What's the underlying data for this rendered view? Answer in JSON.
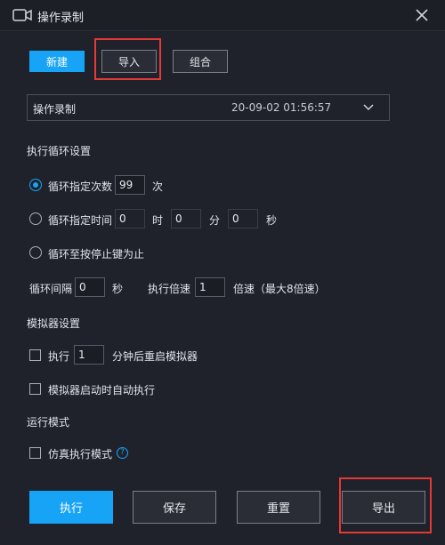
{
  "window": {
    "title": "操作录制",
    "close_icon": "close-icon"
  },
  "toolbar": {
    "new_label": "新建",
    "import_label": "导入",
    "combine_label": "组合"
  },
  "recording": {
    "name": "操作录制",
    "time": "20-09-02 01:56:57"
  },
  "loop": {
    "section_title": "执行循环设置",
    "opt_count_label": "循环指定次数",
    "count_value": "99",
    "count_unit": "次",
    "opt_time_label": "循环指定时间",
    "hours_value": "0",
    "hours_unit": "时",
    "minutes_value": "0",
    "minutes_unit": "分",
    "seconds_value": "0",
    "seconds_unit": "秒",
    "opt_until_stop_label": "循环至按停止键为止",
    "interval_label": "循环间隔",
    "interval_value": "0",
    "interval_unit": "秒",
    "speed_label": "执行倍速",
    "speed_value": "1",
    "speed_unit": "倍速（最大8倍速）",
    "selected": "count"
  },
  "emulator": {
    "section_title": "模拟器设置",
    "restart_prefix": "执行",
    "restart_value": "1",
    "restart_suffix": "分钟后重启模拟器",
    "autorun_label": "模拟器启动时自动执行"
  },
  "mode": {
    "section_title": "运行模式",
    "simulate_label": "仿真执行模式",
    "help_glyph": "?"
  },
  "footer": {
    "run_label": "执行",
    "save_label": "保存",
    "reset_label": "重置",
    "export_label": "导出"
  },
  "colors": {
    "accent": "#17a4f6",
    "highlight": "#e53935",
    "background": "#1f222a"
  }
}
